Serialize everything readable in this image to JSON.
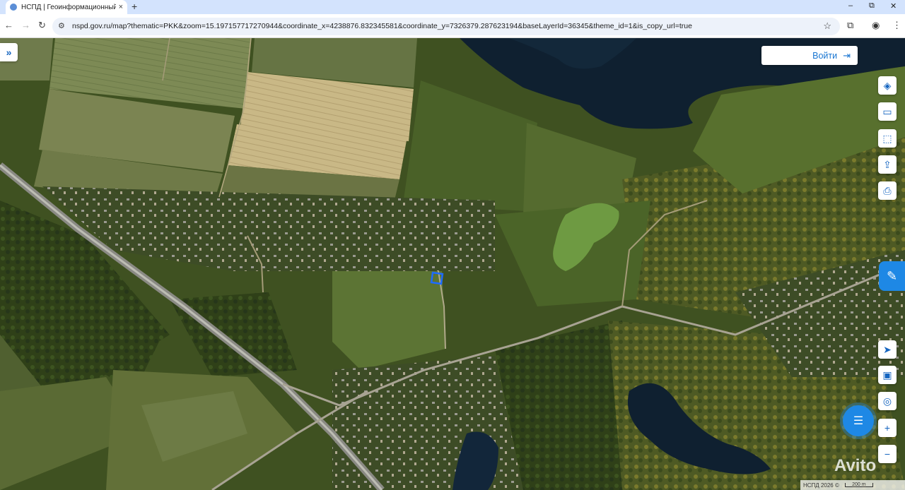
{
  "browser": {
    "tab_title": "НСПД | Геоинформационный",
    "tab_close": "×",
    "new_tab": "+",
    "win_min": "–",
    "win_max": "⧉",
    "win_close": "✕",
    "url": "nspd.gov.ru/map?thematic=PKK&zoom=15.197157717270944&coordinate_x=4238876.832345581&coordinate_y=7326379.287623194&baseLayerId=36345&theme_id=1&is_copy_url=true"
  },
  "map": {
    "login_label": "Войти",
    "attribution": "НСПД 2026 ©",
    "scale_label": "200 m",
    "watermark": "Avito",
    "right_buttons": [
      {
        "name": "layers-button",
        "icon": "layers-icon",
        "glyph": "◈"
      },
      {
        "name": "ruler-button",
        "icon": "ruler-icon",
        "glyph": "▭"
      },
      {
        "name": "select-area-button",
        "icon": "select-area-icon",
        "glyph": "⬚"
      },
      {
        "name": "share-button",
        "icon": "share-icon",
        "glyph": "⇪"
      },
      {
        "name": "print-button",
        "icon": "print-icon",
        "glyph": "⎙"
      }
    ],
    "bottom_buttons": [
      {
        "name": "geolocation-button",
        "icon": "navigation-arrow-icon",
        "glyph": "➤"
      },
      {
        "name": "minimap-button",
        "icon": "minimap-icon",
        "glyph": "▣"
      },
      {
        "name": "search-location-button",
        "icon": "location-search-icon",
        "glyph": "◎"
      },
      {
        "name": "zoom-in-button",
        "icon": "plus-icon",
        "glyph": "+"
      },
      {
        "name": "zoom-out-button",
        "icon": "minus-icon",
        "glyph": "−"
      }
    ],
    "colors": {
      "accent": "#1e88e5",
      "parcel_outline": "#1e6bff"
    }
  }
}
